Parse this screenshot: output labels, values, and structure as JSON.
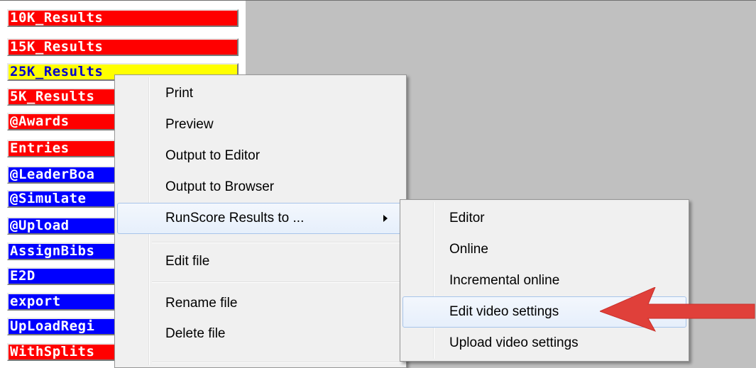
{
  "file_list": [
    {
      "label": "10K_Results",
      "color": "red"
    },
    {
      "label": "15K_Results",
      "color": "red"
    },
    {
      "label": "25K_Results",
      "color": "yellow"
    },
    {
      "label": "5K_Results",
      "color": "red"
    },
    {
      "label": "@Awards",
      "color": "red"
    },
    {
      "label": "Entries",
      "color": "red"
    },
    {
      "label": "@LeaderBoa",
      "color": "blue"
    },
    {
      "label": "@Simulate",
      "color": "blue"
    },
    {
      "label": "@Upload",
      "color": "blue"
    },
    {
      "label": "AssignBibs",
      "color": "blue"
    },
    {
      "label": "E2D",
      "color": "blue"
    },
    {
      "label": "export",
      "color": "blue"
    },
    {
      "label": "UpLoadRegi",
      "color": "blue"
    },
    {
      "label": "WithSplits",
      "color": "red"
    }
  ],
  "context_menu": {
    "items": [
      {
        "label": "Print"
      },
      {
        "label": "Preview"
      },
      {
        "label": "Output to Editor"
      },
      {
        "label": "Output to Browser"
      },
      {
        "label": "RunScore Results to ...",
        "has_submenu": true
      },
      {
        "label": "Edit file"
      },
      {
        "label": "Rename file"
      },
      {
        "label": "Delete file"
      }
    ]
  },
  "submenu": {
    "items": [
      {
        "label": "Editor"
      },
      {
        "label": "Online"
      },
      {
        "label": "Incremental online"
      },
      {
        "label": "Edit video settings",
        "highlighted": true
      },
      {
        "label": "Upload video settings"
      }
    ]
  },
  "colors": {
    "red": "#ff0000",
    "yellow": "#ffff00",
    "blue": "#0000ff",
    "annotation_arrow": "#e0403a",
    "menu_bg": "#f0f0f0",
    "highlight_border": "#a7c4ea"
  },
  "icons": {
    "submenu_arrow": "chevron-right-icon",
    "annotation": "red-arrow-pointer"
  }
}
